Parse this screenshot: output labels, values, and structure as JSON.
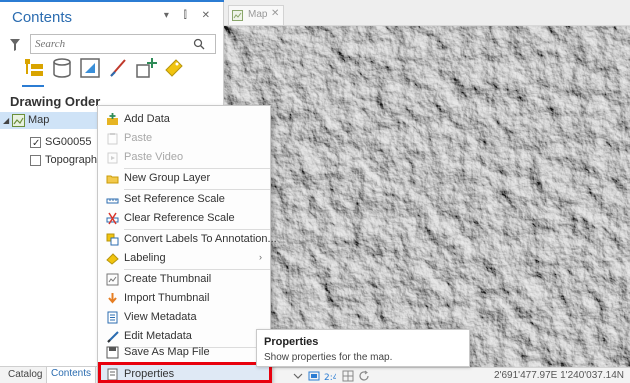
{
  "contents_pane": {
    "title": "Contents",
    "controls": "▾ ⫿ ✕",
    "search": {
      "placeholder": "Search"
    },
    "heading": "Drawing Order",
    "tree": {
      "map": "Map",
      "layers": [
        {
          "label": "SG00055",
          "checked": true
        },
        {
          "label": "Topographic",
          "checked": false
        }
      ]
    },
    "tabs": {
      "catalog": "Catalog",
      "contents": "Contents"
    }
  },
  "map_view": {
    "tab_label": "Map",
    "tab_close": "✕",
    "coordinates": "2'691'477.97E 1'240'037.14N"
  },
  "context_menu": {
    "items": [
      {
        "label": "Add Data",
        "icon": "add-data-icon"
      },
      {
        "label": "Paste",
        "icon": "paste-icon",
        "disabled": true
      },
      {
        "label": "Paste Video",
        "icon": "paste-video-icon",
        "disabled": true
      },
      {
        "label": "New Group Layer",
        "icon": "group-layer-icon"
      },
      {
        "label": "Set Reference Scale",
        "icon": "set-scale-icon"
      },
      {
        "label": "Clear Reference Scale",
        "icon": "clear-scale-icon"
      },
      {
        "label": "Convert Labels To Annotation...",
        "icon": "convert-labels-icon"
      },
      {
        "label": "Labeling",
        "icon": "labeling-icon",
        "submenu": "›"
      },
      {
        "label": "Create Thumbnail",
        "icon": "create-thumbnail-icon"
      },
      {
        "label": "Import Thumbnail",
        "icon": "import-thumbnail-icon"
      },
      {
        "label": "View Metadata",
        "icon": "view-metadata-icon"
      },
      {
        "label": "Edit Metadata",
        "icon": "edit-metadata-icon"
      },
      {
        "label": "Save As Map File",
        "icon": "save-map-file-icon"
      },
      {
        "label": "Properties",
        "icon": "properties-icon"
      }
    ]
  },
  "tooltip": {
    "title": "Properties",
    "description": "Show properties for the map."
  },
  "colors": {
    "accent": "#2b7cd3",
    "selection": "#cfe3f7",
    "highlight_box": "#e8000d"
  }
}
